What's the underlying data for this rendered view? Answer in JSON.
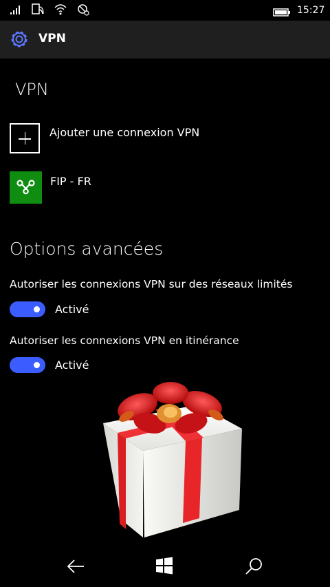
{
  "status_bar": {
    "time": "15:27",
    "icons": [
      "signal-icon",
      "sim-signal-icon",
      "wifi-icon",
      "location-off-icon",
      "battery-icon"
    ]
  },
  "header": {
    "icon": "gear-icon",
    "title": "VPN"
  },
  "page": {
    "title": "VPN"
  },
  "connections": {
    "add_label": "Ajouter une connexion VPN",
    "items": [
      {
        "name": "FIP - FR",
        "icon": "vpn-connection-icon",
        "tile_color": "#108c10"
      }
    ]
  },
  "advanced": {
    "title": "Options avancées",
    "options": [
      {
        "label": "Autoriser les connexions VPN sur des réseaux limités",
        "state": "Activé",
        "on": true
      },
      {
        "label": "Autoriser les connexions VPN en itinérance",
        "state": "Activé",
        "on": true
      }
    ]
  },
  "nav": {
    "back_icon": "back-arrow-icon",
    "home_icon": "windows-logo-icon",
    "search_icon": "search-icon"
  },
  "colors": {
    "accent": "#3b5dff",
    "header_bg": "#1f1f1f",
    "tile": "#108c10"
  }
}
